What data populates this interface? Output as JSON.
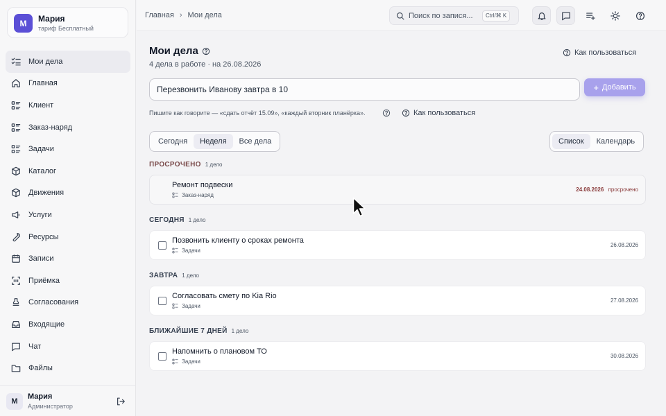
{
  "account": {
    "initial": "М",
    "name": "Мария",
    "plan": "тариф Бесплатный"
  },
  "sidebar": {
    "items": [
      {
        "label": "Мои дела",
        "icon": "checklist-icon",
        "active": true
      },
      {
        "label": "Главная",
        "icon": "home-icon"
      },
      {
        "label": "Клиент",
        "icon": "list-icon"
      },
      {
        "label": "Заказ-наряд",
        "icon": "list-icon"
      },
      {
        "label": "Задачи",
        "icon": "list-icon"
      },
      {
        "label": "Каталог",
        "icon": "box-icon"
      },
      {
        "label": "Движения",
        "icon": "box-icon"
      },
      {
        "label": "Услуги",
        "icon": "megaphone-icon"
      },
      {
        "label": "Ресурсы",
        "icon": "wrench-icon"
      },
      {
        "label": "Записи",
        "icon": "calendar-icon"
      },
      {
        "label": "Приёмка",
        "icon": "scan-icon"
      },
      {
        "label": "Согласования",
        "icon": "stamp-icon"
      },
      {
        "label": "Входящие",
        "icon": "inbox-icon"
      },
      {
        "label": "Чат",
        "icon": "chat-icon"
      },
      {
        "label": "Файлы",
        "icon": "folder-icon"
      }
    ]
  },
  "user": {
    "initial": "М",
    "name": "Мария",
    "role": "Администратор"
  },
  "breadcrumb": {
    "home": "Главная",
    "current": "Мои дела"
  },
  "search": {
    "placeholder": "Поиск по запися...",
    "shortcut": "Ctrl/⌘ K"
  },
  "page": {
    "title": "Мои дела",
    "subtitle": "4 дела в работе · на 26.08.2026",
    "how_to": "Как пользоваться"
  },
  "quick_add": {
    "value": "Перезвонить Иванову завтра в 10",
    "button": "Добавить",
    "hint": "Пишите как говорите — «сдать отчёт 15.09», «каждый вторник планёрка».",
    "how_to": "Как пользоваться"
  },
  "period_tabs": [
    "Сегодня",
    "Неделя",
    "Все дела"
  ],
  "period_active": "Неделя",
  "view_tabs": [
    "Список",
    "Календарь"
  ],
  "view_active": "Список",
  "groups": [
    {
      "label": "ПРОСРОЧЕНО",
      "count": "1 дело",
      "tasks": [
        {
          "name": "Ремонт подвески",
          "category": "Заказ-наряд",
          "date": "24.08.2026",
          "status": "просрочено"
        }
      ]
    },
    {
      "label": "СЕГОДНЯ",
      "count": "1 дело",
      "tasks": [
        {
          "name": "Позвонить клиенту о сроках ремонта",
          "category": "Задачи",
          "date": "26.08.2026"
        }
      ]
    },
    {
      "label": "ЗАВТРА",
      "count": "1 дело",
      "tasks": [
        {
          "name": "Согласовать смету по Kia Rio",
          "category": "Задачи",
          "date": "27.08.2026"
        }
      ]
    },
    {
      "label": "БЛИЖАЙШИЕ 7 ДНЕЙ",
      "count": "1 дело",
      "tasks": [
        {
          "name": "Напомнить о плановом ТО",
          "category": "Задачи",
          "date": "30.08.2026"
        }
      ]
    }
  ]
}
